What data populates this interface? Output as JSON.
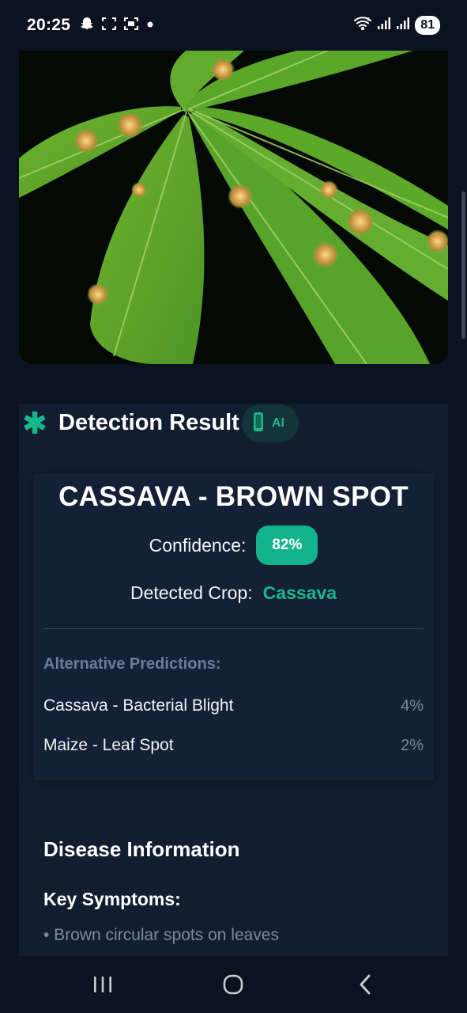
{
  "status_bar": {
    "time": "20:25",
    "battery": "81",
    "icons_left": [
      "snapchat-icon",
      "screenshot-icon",
      "screen-record-icon",
      "dot-icon"
    ],
    "icons_right": [
      "wifi-icon",
      "signal-icon",
      "signal-icon",
      "battery-icon"
    ]
  },
  "header": {
    "title": "Detection Result",
    "ai_badge": "AI",
    "accent": "#14b88c"
  },
  "result": {
    "disease": "CASSAVA - BROWN SPOT",
    "confidence_label": "Confidence:",
    "confidence_value": "82%",
    "crop_label": "Detected Crop:",
    "crop_value": "Cassava"
  },
  "alternatives": {
    "title": "Alternative Predictions:",
    "items": [
      {
        "name": "Cassava - Bacterial Blight",
        "pct": "4%"
      },
      {
        "name": "Maize - Leaf Spot",
        "pct": "2%"
      }
    ]
  },
  "disease_info": {
    "title": "Disease Information",
    "symptoms_title": "Key Symptoms:",
    "symptoms": [
      "• Brown circular spots on leaves"
    ]
  },
  "nav": {
    "icons": [
      "recent-apps-icon",
      "home-icon",
      "back-icon"
    ]
  }
}
